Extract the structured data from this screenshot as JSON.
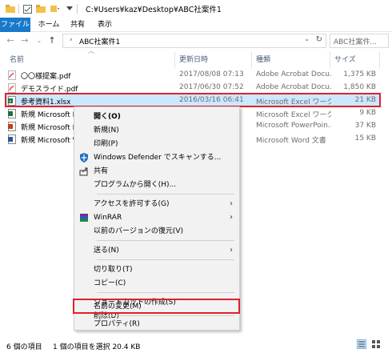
{
  "window": {
    "title": "C:¥Users¥kaz¥Desktop¥ABC社案件1"
  },
  "ribbon": {
    "tabs": [
      "ファイル",
      "ホーム",
      "共有",
      "表示"
    ]
  },
  "address": {
    "breadcrumb": "ABC社案件1",
    "search_placeholder": "ABC社案件..."
  },
  "columns": {
    "name": "名前",
    "modified": "更新日時",
    "type": "種類",
    "size": "サイズ"
  },
  "files": [
    {
      "name": "〇〇様提案.pdf",
      "modified": "2017/08/08 07:13",
      "type": "Adobe Acrobat Docu...",
      "size": "1,375 KB",
      "icon": "pdf-icon"
    },
    {
      "name": "デモスライド.pdf",
      "modified": "2017/06/30 07:52",
      "type": "Adobe Acrobat Docu...",
      "size": "1,850 KB",
      "icon": "pdf-icon"
    },
    {
      "name": "参考資料1.xlsx",
      "modified": "2016/03/16 06:41",
      "type": "Microsoft Excel ワーク...",
      "size": "21 KB",
      "icon": "excel-icon"
    },
    {
      "name": "新規 Microsoft Ex",
      "modified": "",
      "type": "Microsoft Excel ワーク...",
      "size": "9 KB",
      "icon": "excel-icon"
    },
    {
      "name": "新規 Microsoft Po",
      "modified": "",
      "type": "Microsoft PowerPoin...",
      "size": "37 KB",
      "icon": "powerpoint-icon"
    },
    {
      "name": "新規 Microsoft W",
      "modified": "",
      "type": "Microsoft Word 文書",
      "size": "15 KB",
      "icon": "word-icon"
    }
  ],
  "context_menu": {
    "open": "開く(O)",
    "new": "新規(N)",
    "print": "印刷(P)",
    "defender": "Windows Defender でスキャンする...",
    "share": "共有",
    "open_with": "プログラムから開く(H)...",
    "give_access": "アクセスを許可する(G)",
    "winrar": "WinRAR",
    "restore": "以前のバージョンの復元(V)",
    "send_to": "送る(N)",
    "cut": "切り取り(T)",
    "copy": "コピー(C)",
    "create_shortcut": "ショートカットの作成(S)",
    "delete": "削除(D)",
    "rename": "名前の変更(M)",
    "properties": "プロパティ(R)"
  },
  "status": {
    "item_count": "6 個の項目",
    "selected": "1 個の項目を選択  20.4 KB"
  },
  "colors": {
    "accent": "#1979ca",
    "selection": "#cce8ff",
    "highlight_box": "#e0202a"
  }
}
